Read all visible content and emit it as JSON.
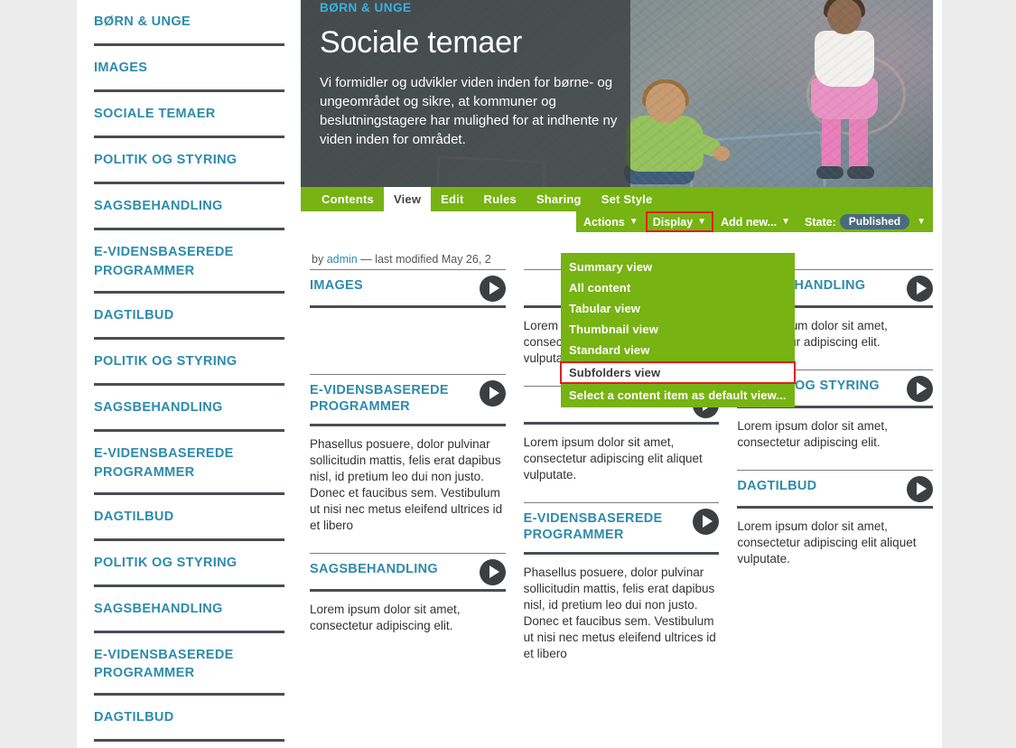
{
  "sidebar": {
    "items": [
      {
        "label": "BØRN & UNGE"
      },
      {
        "label": "IMAGES"
      },
      {
        "label": "SOCIALE TEMAER"
      },
      {
        "label": "POLITIK OG STYRING"
      },
      {
        "label": "SAGSBEHANDLING"
      },
      {
        "label": "E-VIDENSBASEREDE PROGRAMMER"
      },
      {
        "label": "DAGTILBUD"
      },
      {
        "label": "POLITIK OG STYRING"
      },
      {
        "label": "SAGSBEHANDLING"
      },
      {
        "label": "E-VIDENSBASEREDE PROGRAMMER"
      },
      {
        "label": "DAGTILBUD"
      },
      {
        "label": "POLITIK OG STYRING"
      },
      {
        "label": "SAGSBEHANDLING"
      },
      {
        "label": "E-VIDENSBASEREDE PROGRAMMER"
      },
      {
        "label": "DAGTILBUD"
      }
    ]
  },
  "hero": {
    "kicker": "BØRN & UNGE",
    "title": "Sociale temaer",
    "description": "Vi formidler og udvikler viden inden for børne- og ungeområdet og sikre, at kommuner og beslutningstagere har mulighed for at indhente ny viden inden for området."
  },
  "editbar": {
    "tabs": [
      {
        "label": "Contents",
        "selected": false
      },
      {
        "label": "View",
        "selected": true
      },
      {
        "label": "Edit",
        "selected": false
      },
      {
        "label": "Rules",
        "selected": false
      },
      {
        "label": "Sharing",
        "selected": false
      },
      {
        "label": "Set Style",
        "selected": false
      }
    ],
    "actions_label": "Actions",
    "display_label": "Display",
    "add_new_label": "Add new...",
    "state_label": "State:",
    "state_value": "Published",
    "caret": "▼"
  },
  "byline": {
    "prefix": "by",
    "author": "admin",
    "suffix": "— last modified May 26, 2"
  },
  "display_menu": {
    "items": [
      {
        "label": "Summary view",
        "selected": false
      },
      {
        "label": "All content",
        "selected": false
      },
      {
        "label": "Tabular view",
        "selected": false
      },
      {
        "label": "Thumbnail view",
        "selected": false
      },
      {
        "label": "Standard view",
        "selected": false
      },
      {
        "label": "Subfolders view",
        "selected": true
      },
      {
        "label": "Select a content item as default view...",
        "selected": false
      }
    ]
  },
  "colors": {
    "plone_green": "#76b313",
    "link_teal": "#2e8bac",
    "highlight_red": "#e51b1b",
    "divider_dark": "#4a4e52",
    "state_pill": "#4a6b7c",
    "page_bg": "#ececec"
  },
  "grid": {
    "columns": [
      {
        "cards": [
          {
            "title": "IMAGES",
            "body": "",
            "arrow": "play-arrow-icon"
          },
          {
            "title": "E-VIDENSBASEREDE PROGRAMMER",
            "body": "Phasellus posuere, dolor pulvinar sollicitudin mattis, felis erat dapibus nisl, id pretium leo dui non justo. Donec et faucibus sem. Vestibulum ut nisi nec metus eleifend ultrices id et libero",
            "arrow": "play-arrow-icon"
          },
          {
            "title": "SAGSBEHANDLING",
            "body": "Lorem ipsum dolor sit amet, consectetur adipiscing elit.",
            "arrow": "play-arrow-icon"
          }
        ]
      },
      {
        "cards": [
          {
            "title": "",
            "body": "Lorem ipsum dolor sit amet, consectetur adipiscing elit aliquet vulputate.",
            "arrow": "play-arrow-icon"
          },
          {
            "title": "",
            "body": "Lorem ipsum dolor sit amet, consectetur adipiscing elit aliquet vulputate.",
            "arrow": "play-arrow-icon"
          },
          {
            "title": "E-VIDENSBASEREDE PROGRAMMER",
            "body": "Phasellus posuere, dolor pulvinar sollicitudin mattis, felis erat dapibus nisl, id pretium leo dui non justo. Donec et faucibus sem. Vestibulum ut nisi nec metus eleifend ultrices id et libero",
            "arrow": "play-arrow-icon"
          }
        ]
      },
      {
        "cards": [
          {
            "title": "SAGSBEHANDLING",
            "body": "Lorem ipsum dolor sit amet, consectetur adipiscing elit.",
            "arrow": "play-arrow-icon"
          },
          {
            "title": "POLITIK OG STYRING",
            "body": "Lorem ipsum dolor sit amet, consectetur adipiscing elit.",
            "arrow": "play-arrow-icon"
          },
          {
            "title": "DAGTILBUD",
            "body": "Lorem ipsum dolor sit amet, consectetur adipiscing elit aliquet vulputate.",
            "arrow": "play-arrow-icon"
          }
        ]
      }
    ]
  }
}
